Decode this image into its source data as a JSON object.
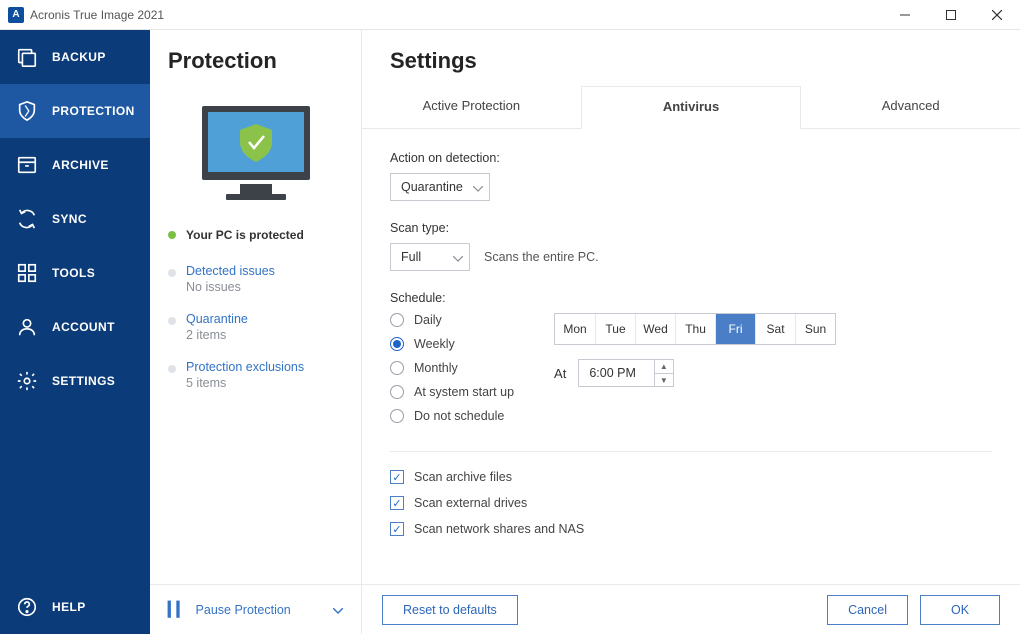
{
  "app": {
    "title": "Acronis True Image 2021",
    "logo_letter": "A"
  },
  "sidebar": {
    "items": [
      {
        "label": "BACKUP",
        "name": "backup"
      },
      {
        "label": "PROTECTION",
        "name": "protection",
        "active": true
      },
      {
        "label": "ARCHIVE",
        "name": "archive"
      },
      {
        "label": "SYNC",
        "name": "sync"
      },
      {
        "label": "TOOLS",
        "name": "tools"
      },
      {
        "label": "ACCOUNT",
        "name": "account"
      },
      {
        "label": "SETTINGS",
        "name": "settings"
      }
    ],
    "help_label": "HELP"
  },
  "panel": {
    "title": "Protection",
    "status": "Your PC is protected",
    "links": [
      {
        "title": "Detected issues",
        "sub": "No issues"
      },
      {
        "title": "Quarantine",
        "sub": "2 items"
      },
      {
        "title": "Protection exclusions",
        "sub": "5 items"
      }
    ],
    "pause_label": "Pause Protection"
  },
  "settings": {
    "title": "Settings",
    "tabs": [
      {
        "label": "Active Protection"
      },
      {
        "label": "Antivirus",
        "active": true
      },
      {
        "label": "Advanced"
      }
    ],
    "action_label": "Action on detection:",
    "action_value": "Quarantine",
    "scan_type_label": "Scan type:",
    "scan_type_value": "Full",
    "scan_type_hint": "Scans the entire PC.",
    "schedule_label": "Schedule:",
    "schedule_options": [
      "Daily",
      "Weekly",
      "Monthly",
      "At system start up",
      "Do not schedule"
    ],
    "schedule_selected": "Weekly",
    "days": [
      "Mon",
      "Tue",
      "Wed",
      "Thu",
      "Fri",
      "Sat",
      "Sun"
    ],
    "day_selected": "Fri",
    "time_label": "At",
    "time_value": "6:00 PM",
    "checks": [
      "Scan archive files",
      "Scan external drives",
      "Scan network shares and NAS"
    ],
    "reset_label": "Reset to defaults",
    "cancel_label": "Cancel",
    "ok_label": "OK"
  }
}
